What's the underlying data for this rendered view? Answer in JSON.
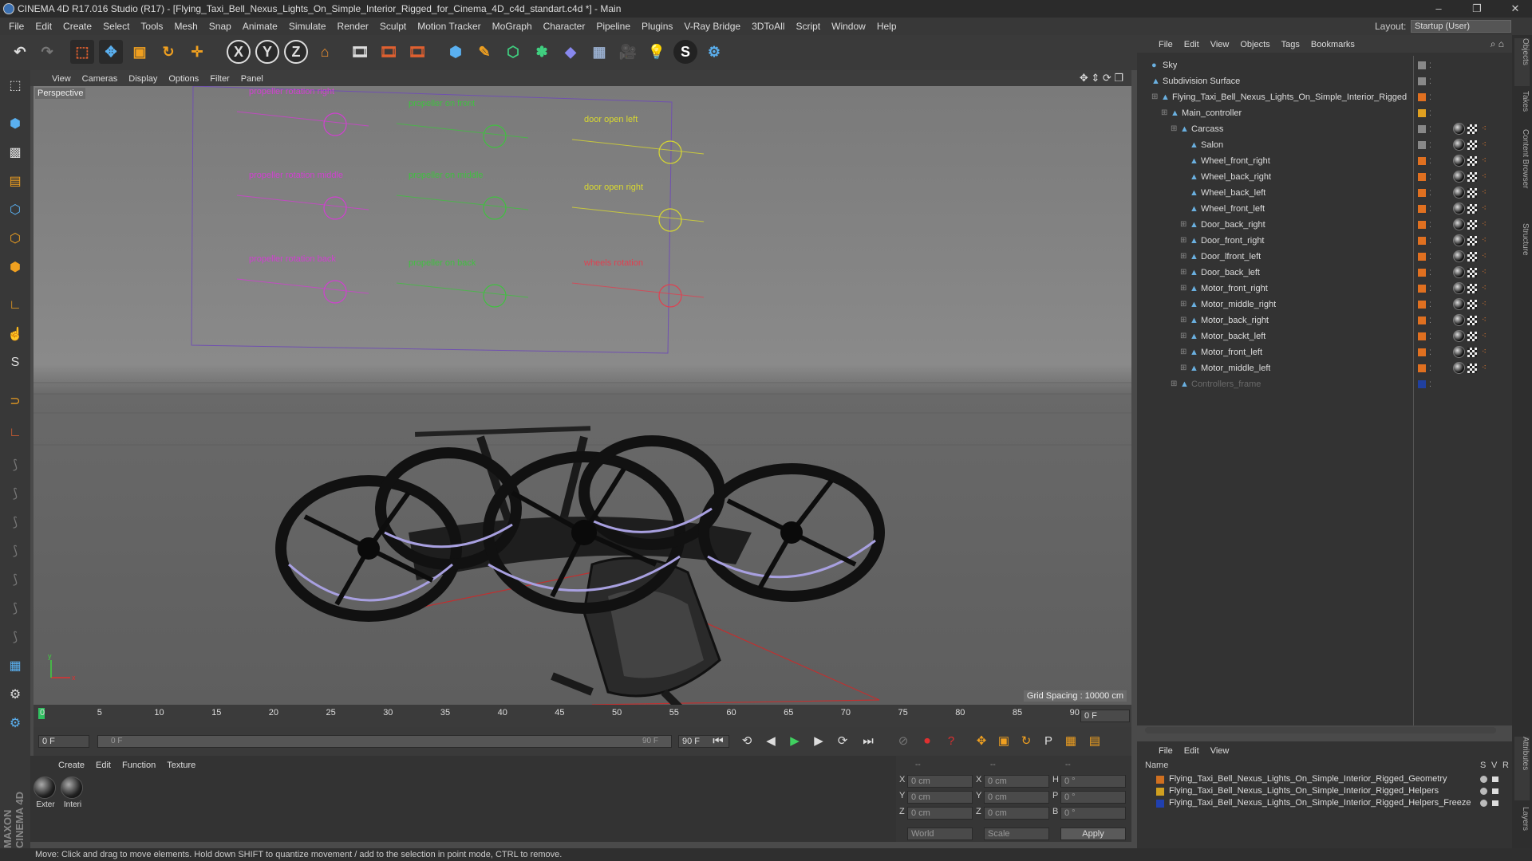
{
  "window": {
    "title": "CINEMA 4D R17.016 Studio (R17) - [Flying_Taxi_Bell_Nexus_Lights_On_Simple_Interior_Rigged_for_Cinema_4D_c4d_standart.c4d *] - Main",
    "minimize": "–",
    "maximize": "❐",
    "close": "✕"
  },
  "menubar": {
    "items": [
      "File",
      "Edit",
      "Create",
      "Select",
      "Tools",
      "Mesh",
      "Snap",
      "Animate",
      "Simulate",
      "Render",
      "Sculpt",
      "Motion Tracker",
      "MoGraph",
      "Character",
      "Pipeline",
      "Plugins",
      "V-Ray Bridge",
      "3DToAll",
      "Script",
      "Window",
      "Help"
    ],
    "layout_label": "Layout:",
    "layout_value": "Startup (User)"
  },
  "viewport": {
    "menu": [
      "View",
      "Cameras",
      "Display",
      "Options",
      "Filter",
      "Panel"
    ],
    "label": "Perspective",
    "grid_spacing": "Grid Spacing : 10000 cm",
    "controllers": [
      {
        "label": "propeller rotation right",
        "color": "#d040d0"
      },
      {
        "label": "propeller rotation middle",
        "color": "#d040d0"
      },
      {
        "label": "propeller rotation back",
        "color": "#d040d0"
      },
      {
        "label": "propeller on front",
        "color": "#40c040"
      },
      {
        "label": "propeller on middle",
        "color": "#40c040"
      },
      {
        "label": "propeller on back",
        "color": "#40c040"
      },
      {
        "label": "door open left",
        "color": "#d8d830"
      },
      {
        "label": "door open right",
        "color": "#d8d830"
      },
      {
        "label": "wheels rotation",
        "color": "#e04050"
      }
    ]
  },
  "timeline": {
    "ticks": [
      "0",
      "5",
      "10",
      "15",
      "20",
      "25",
      "30",
      "35",
      "40",
      "45",
      "50",
      "55",
      "60",
      "65",
      "70",
      "75",
      "80",
      "85",
      "90"
    ],
    "current_frame": "0 F"
  },
  "transport": {
    "start_field": "0 F",
    "range_start": "0 F",
    "range_end": "90 F",
    "end_field": "90 F"
  },
  "material_panel": {
    "menu": [
      "Create",
      "Edit",
      "Function",
      "Texture"
    ],
    "materials": [
      {
        "name": "Exter"
      },
      {
        "name": "Interi"
      }
    ]
  },
  "coords": {
    "header_left": "--",
    "header_mid": "--",
    "header_right": "--",
    "rows": [
      {
        "axis": "X",
        "pos": "0 cm",
        "axis2": "X",
        "size": "0 cm",
        "rot_axis": "H",
        "rot": "0 °"
      },
      {
        "axis": "Y",
        "pos": "0 cm",
        "axis2": "Y",
        "size": "0 cm",
        "rot_axis": "P",
        "rot": "0 °"
      },
      {
        "axis": "Z",
        "pos": "0 cm",
        "axis2": "Z",
        "size": "0 cm",
        "rot_axis": "B",
        "rot": "0 °"
      }
    ],
    "world": "World",
    "scale": "Scale",
    "apply": "Apply"
  },
  "status": "Move: Click and drag to move elements. Hold down SHIFT to quantize movement / add to the selection in point mode, CTRL to remove.",
  "object_manager": {
    "menu": [
      "File",
      "Edit",
      "View",
      "Objects",
      "Tags",
      "Bookmarks"
    ],
    "objects": [
      {
        "name": "Sky",
        "indent": 0,
        "color": "#888"
      },
      {
        "name": "Subdivision Surface",
        "indent": 0,
        "color": "#888"
      },
      {
        "name": "Flying_Taxi_Bell_Nexus_Lights_On_Simple_Interior_Rigged",
        "indent": 1,
        "color": "#e07020"
      },
      {
        "name": "Main_controller",
        "indent": 2,
        "color": "#e0a020"
      },
      {
        "name": "Carcass",
        "indent": 3,
        "color": "#888"
      },
      {
        "name": "Salon",
        "indent": 4,
        "color": "#888"
      },
      {
        "name": "Wheel_front_right",
        "indent": 4,
        "color": "#e07020"
      },
      {
        "name": "Wheel_back_right",
        "indent": 4,
        "color": "#e07020"
      },
      {
        "name": "Wheel_back_left",
        "indent": 4,
        "color": "#e07020"
      },
      {
        "name": "Wheel_front_left",
        "indent": 4,
        "color": "#e07020"
      },
      {
        "name": "Door_back_right",
        "indent": 4,
        "color": "#e07020"
      },
      {
        "name": "Door_front_right",
        "indent": 4,
        "color": "#e07020"
      },
      {
        "name": "Door_lfront_left",
        "indent": 4,
        "color": "#e07020"
      },
      {
        "name": "Door_back_left",
        "indent": 4,
        "color": "#e07020"
      },
      {
        "name": "Motor_front_right",
        "indent": 4,
        "color": "#e07020"
      },
      {
        "name": "Motor_middle_right",
        "indent": 4,
        "color": "#e07020"
      },
      {
        "name": "Motor_back_right",
        "indent": 4,
        "color": "#e07020"
      },
      {
        "name": "Motor_backt_left",
        "indent": 4,
        "color": "#e07020"
      },
      {
        "name": "Motor_front_left",
        "indent": 4,
        "color": "#e07020"
      },
      {
        "name": "Motor_middle_left",
        "indent": 4,
        "color": "#e07020"
      },
      {
        "name": "Controllers_frame",
        "indent": 3,
        "color": "#2040a0"
      }
    ]
  },
  "layer_manager": {
    "menu": [
      "File",
      "Edit",
      "View"
    ],
    "col_name": "Name",
    "col_s": "S",
    "col_v": "V",
    "col_r": "R",
    "layers": [
      {
        "name": "Flying_Taxi_Bell_Nexus_Lights_On_Simple_Interior_Rigged_Geometry",
        "color": "#d07020"
      },
      {
        "name": "Flying_Taxi_Bell_Nexus_Lights_On_Simple_Interior_Rigged_Helpers",
        "color": "#d0a020"
      },
      {
        "name": "Flying_Taxi_Bell_Nexus_Lights_On_Simple_Interior_Rigged_Helpers_Freeze",
        "color": "#2040b0"
      }
    ]
  },
  "right_tabs": [
    "Objects",
    "Takes",
    "Content Browser",
    "Structure",
    "Attributes",
    "Layers"
  ],
  "brand": "MAXON CINEMA 4D"
}
